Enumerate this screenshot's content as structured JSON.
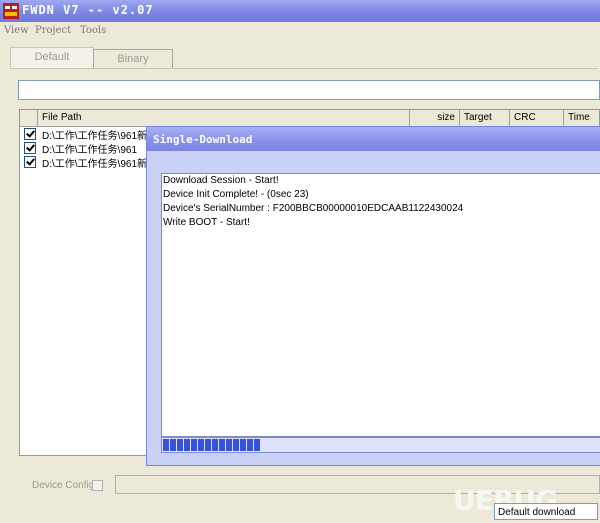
{
  "window": {
    "title": "FWDN V7 -- v2.07",
    "icon": "app-icon"
  },
  "menu": [
    "View",
    "Project",
    "Tools"
  ],
  "tabs": [
    {
      "label": "Default",
      "active": true
    },
    {
      "label": "Binary",
      "active": false
    }
  ],
  "path_input": {
    "value": ""
  },
  "table": {
    "columns": [
      "File Path",
      "size",
      "Target",
      "CRC",
      "Time"
    ],
    "rows": [
      {
        "checked": true,
        "path": "D:\\工作\\工作任务\\961新"
      },
      {
        "checked": true,
        "path": "D:\\工作\\工作任务\\961"
      },
      {
        "checked": true,
        "path": "D:\\工作\\工作任务\\961新"
      }
    ]
  },
  "device_config": {
    "label": "Device Config",
    "checked": false
  },
  "mode_select": {
    "value": "Default download"
  },
  "watermark": "UEBUG",
  "dialog": {
    "title": "Single-Download",
    "log": [
      "Download Session - Start!",
      "Device Init Complete! - (0sec 23)",
      "Device's SerialNumber : F200BBCB00000010EDCAAB1122430024",
      "Write BOOT - Start!"
    ],
    "progress_blocks": 14,
    "progress_color": "#3652d9"
  },
  "colors": {
    "titlebar": "#7c86e6",
    "dialog_bg": "#c9d2f6",
    "window_bg": "#ece9d8"
  }
}
